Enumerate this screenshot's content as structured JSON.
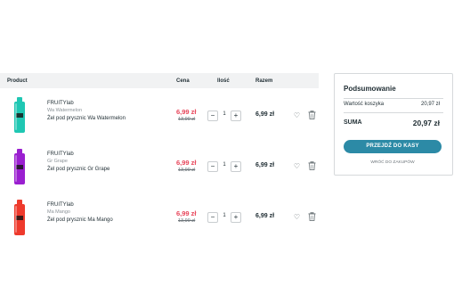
{
  "cart": {
    "headers": {
      "product": "Product",
      "price": "Cena",
      "quantity": "Ilość",
      "total": "Razem"
    },
    "items": [
      {
        "brand": "FRUITYlab",
        "variant": "Wa Watermelon",
        "name": "Żel pod prysznic Wa Watermelon",
        "price_new": "6,99 zł",
        "price_old": "13,99 zł",
        "qty": "1",
        "total": "6,99 zł",
        "bottle_color": "#1fc7b3"
      },
      {
        "brand": "FRUITYlab",
        "variant": "Gr Grape",
        "name": "Żel pod prysznic Gr Grape",
        "price_new": "6,99 zł",
        "price_old": "13,99 zł",
        "qty": "1",
        "total": "6,99 zł",
        "bottle_color": "#9a1fd0"
      },
      {
        "brand": "FRUITYlab",
        "variant": "Ma Mango",
        "name": "Żel pod prysznic Ma Mango",
        "price_new": "6,99 zł",
        "price_old": "13,99 zł",
        "qty": "1",
        "total": "6,99 zł",
        "bottle_color": "#ee3a2c"
      }
    ],
    "minus": "−",
    "plus": "+"
  },
  "summary": {
    "title": "Podsumowanie",
    "cart_value_label": "Wartość koszyka",
    "cart_value": "20,97 zł",
    "total_label": "SUMA",
    "total_value": "20,97 zł",
    "checkout_label": "PRZEJDŹ DO KASY",
    "back_label": "WRÓĆ DO ZAKUPÓW"
  },
  "colors": {
    "accent": "#2c8aa6",
    "sale": "#e8455a"
  },
  "icons": {
    "wishlist": "heart-icon",
    "remove": "trash-icon"
  }
}
